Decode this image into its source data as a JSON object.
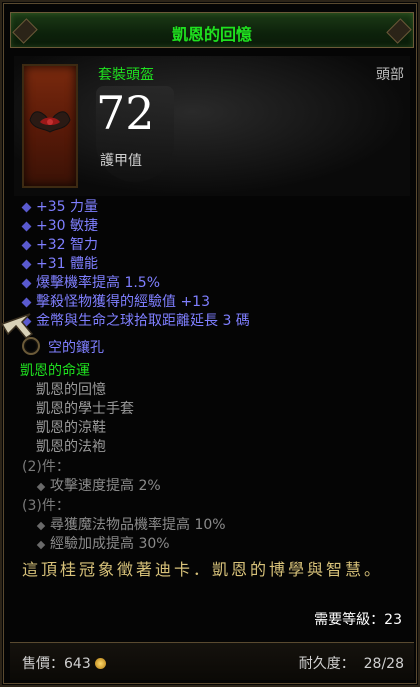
{
  "window": {
    "title": "凱恩的回憶"
  },
  "header": {
    "item_type": "套裝頭盔",
    "slot": "頭部",
    "armor_value": "72",
    "armor_label": "護甲值",
    "icon": "helm-icon"
  },
  "properties": [
    "+35 力量",
    "+30 敏捷",
    "+32 智力",
    "+31 體能",
    "爆擊機率提高 1.5%",
    "擊殺怪物獲得的經驗值 +13",
    "金幣與生命之球拾取距離延長 3 碼"
  ],
  "socket": {
    "label": "空的鑲孔"
  },
  "set": {
    "name": "凱恩的命運",
    "items": [
      "凱恩的回憶",
      "凱恩的學士手套",
      "凱恩的涼鞋",
      "凱恩的法袍"
    ],
    "tier2_label": "(2)件：",
    "tier2_bonus": "攻擊速度提高 2%",
    "tier3_label": "(3)件：",
    "tier3_bonuses": [
      "尋獲魔法物品機率提高 10%",
      "經驗加成提高 30%"
    ]
  },
  "flavor_text": "這頂桂冠象徵著迪卡．凱恩的博學與智慧。",
  "level": "需要等級：23",
  "footer": {
    "sell_label": "售價：",
    "sell_value": "643",
    "durability_label": "耐久度：",
    "durability_value": "28/28"
  },
  "colors": {
    "set_green": "#1fe11f",
    "magic_blue": "#7f7fff",
    "flavor_gold": "#d8c27a"
  }
}
